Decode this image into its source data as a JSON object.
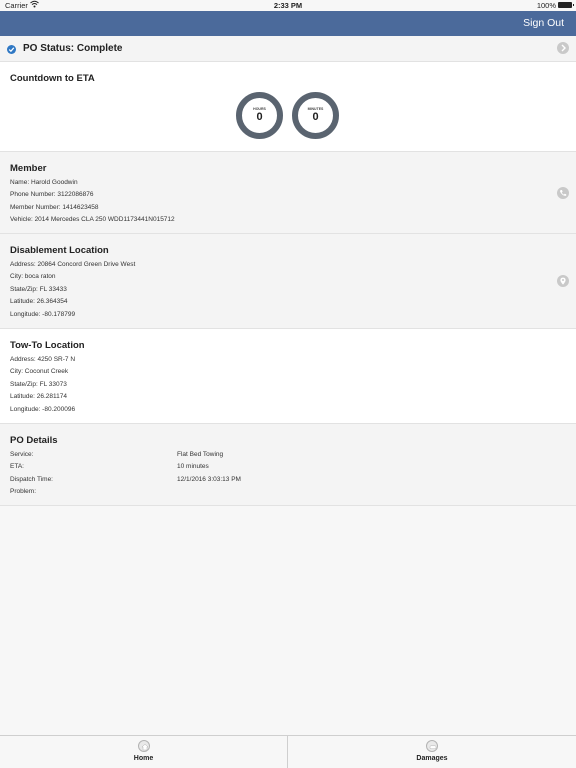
{
  "status_bar": {
    "carrier": "Carrier",
    "time": "2:33 PM",
    "battery": "100%"
  },
  "nav": {
    "sign_out": "Sign Out"
  },
  "po_status": {
    "text": "PO Status: Complete"
  },
  "countdown": {
    "title": "Countdown to ETA",
    "hours_label": "HOURS",
    "hours_value": "0",
    "minutes_label": "MINUTES",
    "minutes_value": "0"
  },
  "member": {
    "title": "Member",
    "name": "Name: Harold Goodwin",
    "phone": "Phone Number: 3122086876",
    "member_number": "Member Number: 1414623458",
    "vehicle": "Vehicle: 2014 Mercedes CLA 250 WDD1173441N015712"
  },
  "disablement": {
    "title": "Disablement Location",
    "address": "Address: 20864 Concord Green Drive West",
    "city": "City: boca raton",
    "state_zip": "State/Zip: FL 33433",
    "latitude": "Latitude: 26.364354",
    "longitude": "Longitude: -80.178799"
  },
  "tow_to": {
    "title": "Tow-To Location",
    "address": "Address: 4250 SR-7 N",
    "city": "City: Coconut Creek",
    "state_zip": "State/Zip: FL 33073",
    "latitude": "Latitude: 26.281174",
    "longitude": "Longitude: -80.200096"
  },
  "po_details": {
    "title": "PO Details",
    "rows": [
      {
        "label": "Service:",
        "value": "Flat Bed Towing"
      },
      {
        "label": "ETA:",
        "value": "10 minutes"
      },
      {
        "label": "Dispatch Time:",
        "value": "12/1/2016 3:03:13 PM"
      },
      {
        "label": "Problem:",
        "value": ""
      }
    ]
  },
  "tabs": [
    {
      "label": "Home",
      "icon": "home-icon"
    },
    {
      "label": "Damages",
      "icon": "damages-icon"
    }
  ],
  "colors": {
    "nav": "#4b6a9b",
    "check": "#2f78c4",
    "dial_ring": "#5a6470"
  }
}
